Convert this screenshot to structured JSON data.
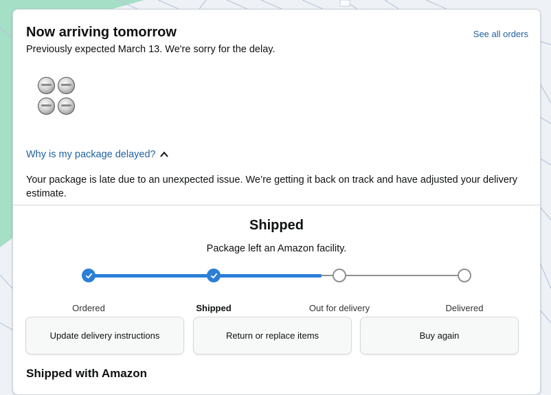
{
  "card": {
    "title": "Now arriving tomorrow",
    "see_all_label": "See all orders",
    "subtitle": "Previously expected March 13. We're sorry for the delay.",
    "product_image_alt": "Product image of four silver button coin cells"
  },
  "delay": {
    "link_label": "Why is my package delayed?",
    "chevron_icon": "chevron-up-icon",
    "explanation": "Your package is late due to an unexpected issue. We’re getting it back on track and have adjusted your delivery estimate."
  },
  "shipment": {
    "status": "Shipped",
    "status_detail": "Package left an Amazon facility.",
    "progress_fraction": 0.62,
    "steps": [
      {
        "label": "Ordered",
        "done": true,
        "active": false
      },
      {
        "label": "Shipped",
        "done": true,
        "active": true
      },
      {
        "label": "Out for delivery",
        "done": false,
        "active": false
      },
      {
        "label": "Delivered",
        "done": false,
        "active": false
      }
    ]
  },
  "actions": {
    "update_label": "Update delivery instructions",
    "return_label": "Return or replace items",
    "buy_again_label": "Buy again"
  },
  "footer": {
    "heading": "Shipped with Amazon"
  },
  "colors": {
    "accent": "#2b7fd6",
    "link": "#2162a1",
    "map_green": "#a5dfc5"
  }
}
